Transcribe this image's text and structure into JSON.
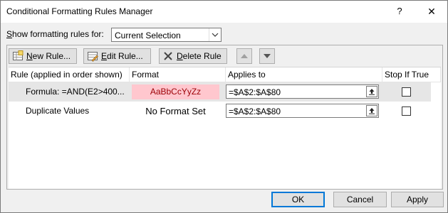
{
  "window": {
    "title": "Conditional Formatting Rules Manager",
    "help_glyph": "?",
    "close_glyph": "✕"
  },
  "scope": {
    "label_prefix": "S",
    "label_rest": "how formatting rules for:",
    "selected": "Current Selection"
  },
  "toolbar": {
    "new_rule_u": "N",
    "new_rule_rest": "ew Rule...",
    "edit_rule_u": "E",
    "edit_rule_rest": "dit Rule...",
    "delete_rule_u": "D",
    "delete_rule_rest": "elete Rule"
  },
  "columns": {
    "rule": "Rule (applied in order shown)",
    "format": "Format",
    "applies_to": "Applies to",
    "stop_if_true": "Stop If True"
  },
  "rules": [
    {
      "rule": "Formula: =AND(E2>400...",
      "format_preview": "AaBbCcYyZz",
      "applies_to": "=$A$2:$A$80",
      "stop_if_true": false,
      "selected": true
    },
    {
      "rule": "Duplicate Values",
      "format_preview": "No Format Set",
      "applies_to": "=$A$2:$A$80",
      "stop_if_true": false,
      "selected": false
    }
  ],
  "buttons": {
    "ok": "OK",
    "cancel": "Cancel",
    "apply": "Apply"
  },
  "colors": {
    "preview_fill": "#ffc7ce",
    "preview_text": "#9c0006",
    "selection": "#e6e6e6",
    "accent": "#0078d7"
  }
}
